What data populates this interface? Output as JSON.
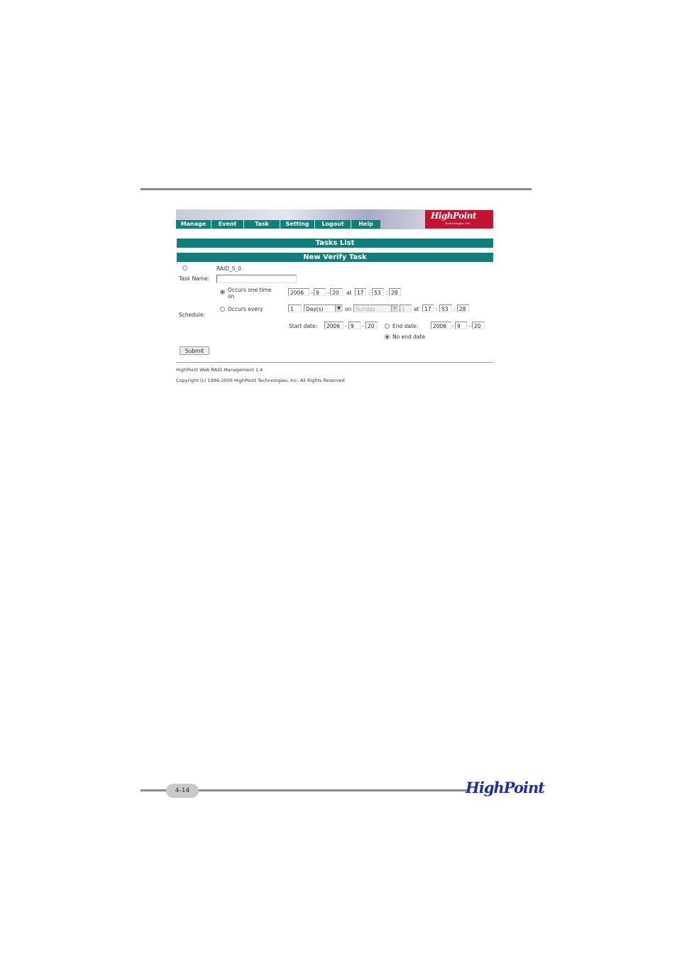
{
  "nav": {
    "items": [
      "Manage",
      "Event",
      "Task",
      "Setting",
      "Logout",
      "Help"
    ]
  },
  "logo": {
    "brand": "HighPoint",
    "tagline": "Technologies, Inc."
  },
  "sections": {
    "tasks_list": "Tasks List",
    "new_verify_task": "New Verify Task"
  },
  "array": {
    "name": "RAID_5_0"
  },
  "task_name": {
    "label": "Task Name:",
    "value": ""
  },
  "schedule": {
    "label": "Schedule:",
    "once": {
      "label_line1": "Occurs one time",
      "label_line2": "on",
      "year": "2006",
      "month": "9",
      "day": "20",
      "at": "at",
      "hour": "17",
      "minute": "53",
      "second": "28"
    },
    "every": {
      "label": "Occurs every",
      "count": "1",
      "unit": "Day(s)",
      "on": "on",
      "weekday": "Sunday",
      "day_num": "1",
      "at": "at",
      "hour": "17",
      "minute": "53",
      "second": "28"
    },
    "start_date": {
      "label": "Start date:",
      "year": "2006",
      "month": "9",
      "day": "20"
    },
    "end_date": {
      "label": "End date:",
      "year": "2006",
      "month": "9",
      "day": "20"
    },
    "no_end_date": "No end date"
  },
  "separators": {
    "dash": "-",
    "colon": ":"
  },
  "submit_label": "Submit",
  "footer": {
    "version": "HighPoint Web RAID Management 1.4",
    "copyright": "Copyright (c) 1996-2006 HighPoint Technologies, Inc. All Rights Reserved"
  },
  "page": {
    "number": "4-14",
    "brand": "HighPoint"
  },
  "colors": {
    "accent": "#0f7f7a",
    "logo_red": "#c4122f",
    "footer_logo": "#1f2bb0"
  }
}
